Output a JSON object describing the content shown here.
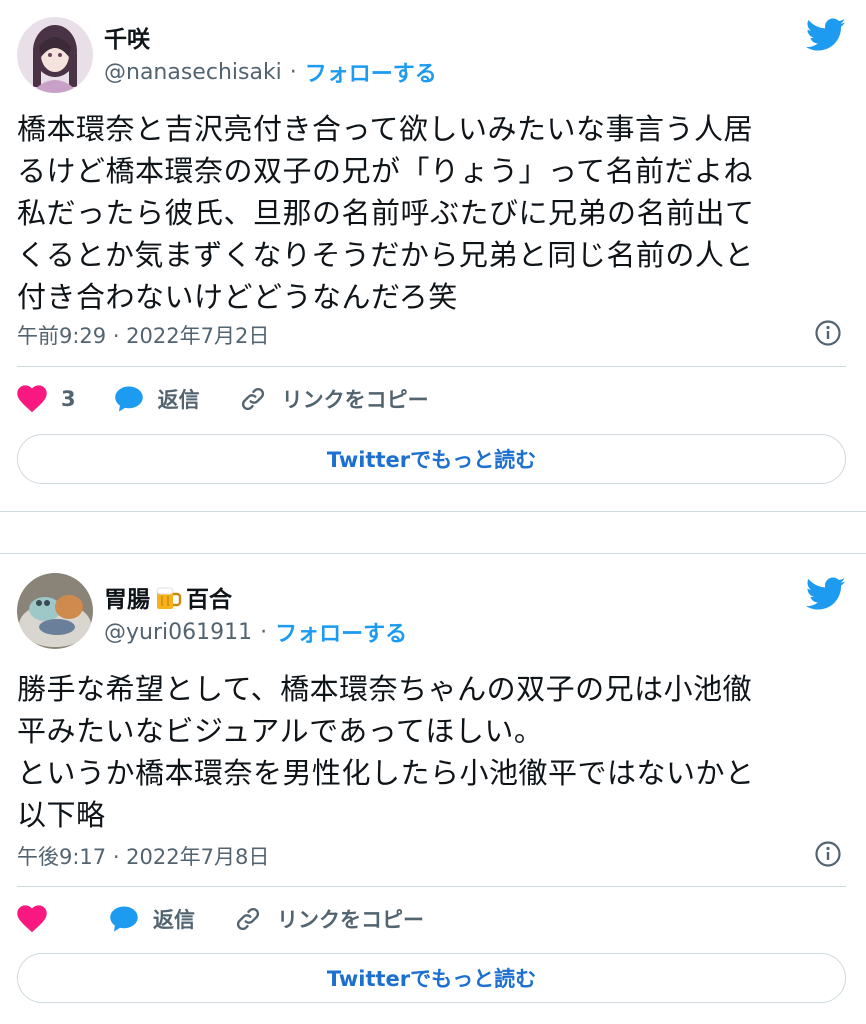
{
  "tweets": [
    {
      "name": "千咲",
      "handle": "@nanasechisaki",
      "separator": "·",
      "follow_label": "フォローする",
      "text": "橋本環奈と吉沢亮付き合って欲しいみたいな事言う人居\nるけど橋本環奈の双子の兄が「りょう」って名前だよね\n私だったら彼氏、旦那の名前呼ぶたびに兄弟の名前出て\nくるとか気まずくなりそうだから兄弟と同じ名前の人と\n付き合わないけどどうなんだろ笑",
      "timestamp": "午前9:29 · 2022年7月2日",
      "like_count": "3",
      "reply_label": "返信",
      "copy_link_label": "リンクをコピー",
      "read_more_label": "Twitterでもっと読む"
    },
    {
      "name": "胃腸",
      "name_suffix": "百合",
      "name_emoji": "beer-mug-icon",
      "handle": "@yuri061911",
      "separator": "·",
      "follow_label": "フォローする",
      "text": "勝手な希望として、橋本環奈ちゃんの双子の兄は小池徹\n平みたいなビジュアルであってほしい。\nというか橋本環奈を男性化したら小池徹平ではないかと\n以下略",
      "timestamp": "午後9:17 · 2022年7月8日",
      "reply_label": "返信",
      "copy_link_label": "リンクをコピー",
      "read_more_label": "Twitterでもっと読む"
    }
  ],
  "colors": {
    "brand_blue": "#1d9bf0",
    "like_pink": "#f91880",
    "text": "#0f1419",
    "muted": "#536471",
    "border": "#cfd9de"
  }
}
